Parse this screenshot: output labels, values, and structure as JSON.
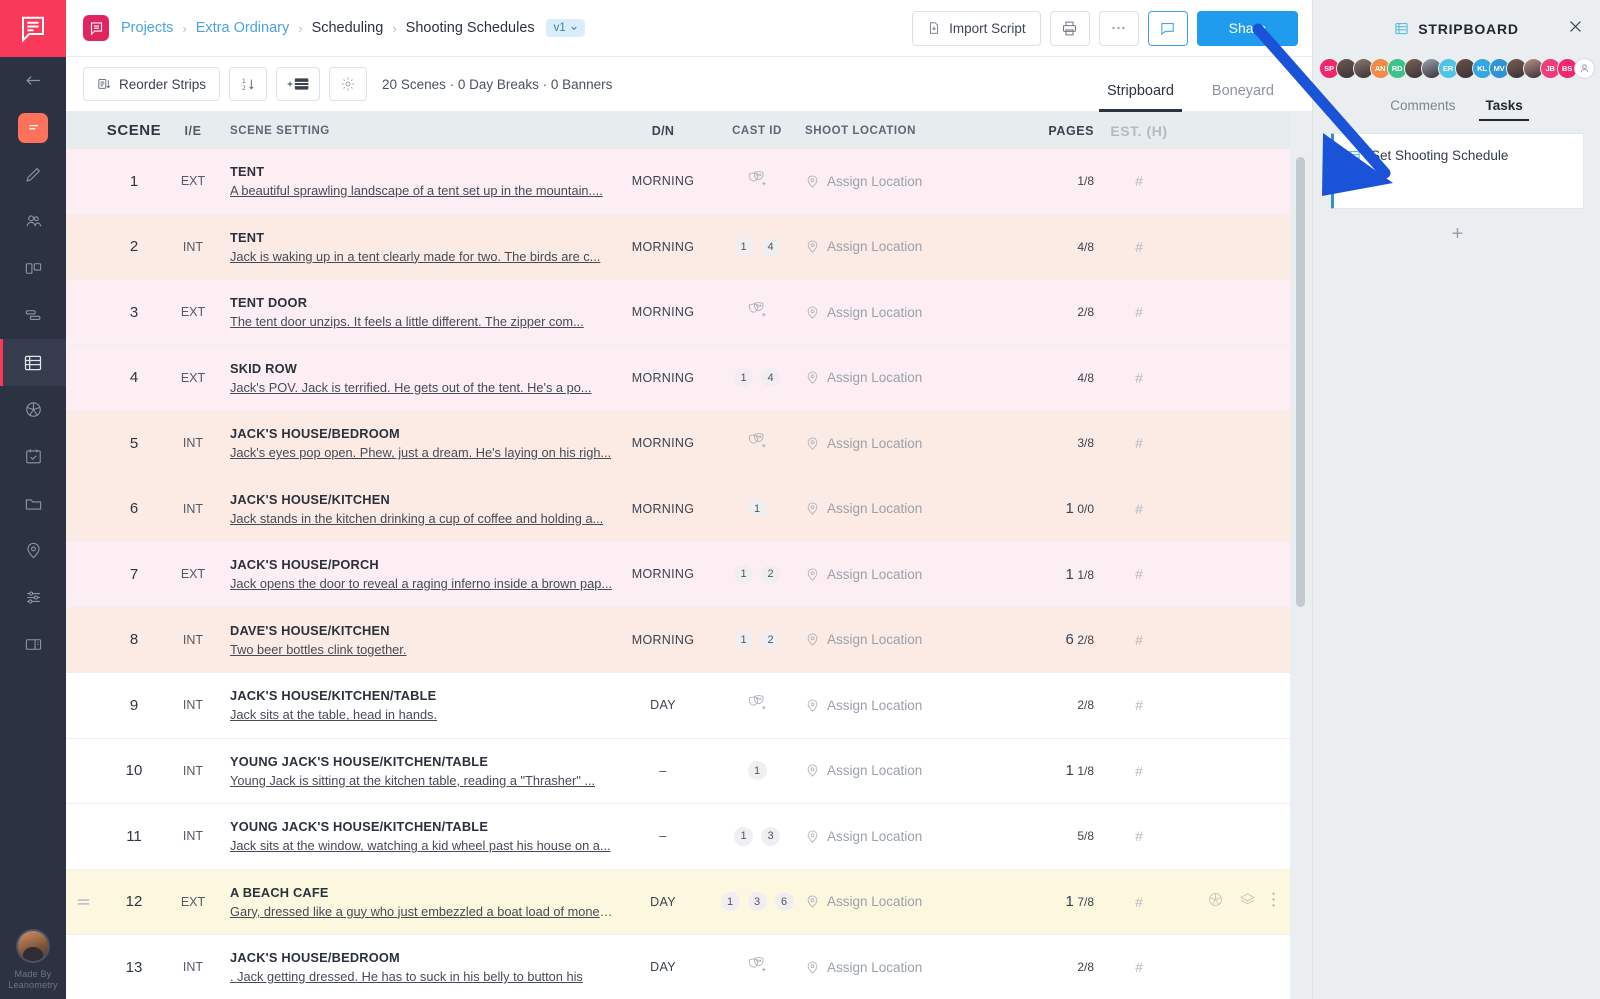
{
  "rail": {
    "logo_icon": "comment-script-logo",
    "items": [
      {
        "name": "collapse-sidebar",
        "icon": "arrow-left-icon"
      },
      {
        "name": "script-tile",
        "icon": "script-tile-icon",
        "active_tile": true
      },
      {
        "name": "write",
        "icon": "pencil-icon"
      },
      {
        "name": "cast",
        "icon": "people-icon"
      },
      {
        "name": "storyboard",
        "icon": "boards-icon"
      },
      {
        "name": "breakdown",
        "icon": "strips-icon"
      },
      {
        "name": "scheduling",
        "icon": "stripboard-icon",
        "selected": true
      },
      {
        "name": "shot-list",
        "icon": "aperture-icon"
      },
      {
        "name": "calendar",
        "icon": "calendar-check-icon"
      },
      {
        "name": "files",
        "icon": "folder-icon"
      },
      {
        "name": "locations",
        "icon": "map-pin-icon"
      },
      {
        "name": "settings-sliders",
        "icon": "sliders-icon"
      },
      {
        "name": "reports",
        "icon": "book-icon"
      }
    ],
    "credit_line1": "Made By",
    "credit_line2": "Leanometry"
  },
  "breadcrumb": {
    "items": [
      {
        "label": "Projects",
        "style": "link"
      },
      {
        "label": "Extra Ordinary",
        "style": "link"
      },
      {
        "label": "Scheduling",
        "style": "dark"
      },
      {
        "label": "Shooting Schedules",
        "style": "dark"
      }
    ],
    "separator": "›",
    "version_label": "v1"
  },
  "topbar": {
    "import_script_label": "Import Script",
    "print_icon": "printer-icon",
    "more_icon": "ellipsis-icon",
    "comments_icon": "comment-bubble-icon",
    "share_label": "Share",
    "share_color": "#209cee"
  },
  "toolbar": {
    "reorder_label": "Reorder Strips",
    "sort_icon": "sort-1-2-icon",
    "add_strip_icon": "add-strip-icon",
    "settings_icon": "gear-icon",
    "meta": "20 Scenes · 0 Day Breaks · 0 Banners",
    "tabs": [
      {
        "label": "Stripboard",
        "active": true
      },
      {
        "label": "Boneyard",
        "active": false
      }
    ]
  },
  "table": {
    "columns": {
      "scene": "SCENE",
      "ie": "I/E",
      "setting": "SCENE SETTING",
      "dn": "D/N",
      "cast": "CAST ID",
      "location": "SHOOT LOCATION",
      "pages": "PAGES",
      "est": "EST. (H)"
    },
    "assign_location_label": "Assign Location",
    "est_placeholder": "#",
    "rows": [
      {
        "scene": "1",
        "ie": "EXT",
        "title": "TENT",
        "desc": "A beautiful sprawling landscape of a tent set up in the mountain....",
        "dn": "MORNING",
        "cast": [],
        "cast_icon": "add-cast-masks-icon",
        "pages_whole": "",
        "pages_frac": "1/8",
        "tint": "pink-light"
      },
      {
        "scene": "2",
        "ie": "INT",
        "title": "TENT",
        "desc": "Jack is waking up in a tent clearly made for two. The birds are c...",
        "dn": "MORNING",
        "cast": [
          "1",
          "4"
        ],
        "pages_whole": "",
        "pages_frac": "4/8",
        "tint": "peach"
      },
      {
        "scene": "3",
        "ie": "EXT",
        "title": "TENT DOOR",
        "desc": "The tent door unzips. It feels a little different. The zipper com...",
        "dn": "MORNING",
        "cast": [],
        "cast_icon": "add-cast-masks-icon",
        "pages_whole": "",
        "pages_frac": "2/8",
        "tint": "pink-light"
      },
      {
        "scene": "4",
        "ie": "EXT",
        "title": "SKID ROW",
        "desc": "Jack's POV. Jack is terrified. He gets out of the tent. He's a po...",
        "dn": "MORNING",
        "cast": [
          "1",
          "4"
        ],
        "pages_whole": "",
        "pages_frac": "4/8",
        "tint": "pink-light"
      },
      {
        "scene": "5",
        "ie": "INT",
        "title": "JACK'S HOUSE/BEDROOM",
        "desc": "Jack's eyes pop open. Phew, just a dream. He's laying on his righ...",
        "dn": "MORNING",
        "cast": [],
        "cast_icon": "add-cast-masks-icon",
        "pages_whole": "",
        "pages_frac": "3/8",
        "tint": "peach"
      },
      {
        "scene": "6",
        "ie": "INT",
        "title": "JACK'S HOUSE/KITCHEN",
        "desc": "Jack stands in the kitchen drinking a cup of coffee and holding a...",
        "dn": "MORNING",
        "cast": [
          "1"
        ],
        "pages_whole": "1",
        "pages_frac": "0/0",
        "tint": "peach"
      },
      {
        "scene": "7",
        "ie": "EXT",
        "title": "JACK'S HOUSE/PORCH",
        "desc": "Jack opens the door to reveal a raging inferno inside a brown pap...",
        "dn": "MORNING",
        "cast": [
          "1",
          "2"
        ],
        "pages_whole": "1",
        "pages_frac": "1/8",
        "tint": "pink-light"
      },
      {
        "scene": "8",
        "ie": "INT",
        "title": "DAVE'S HOUSE/KITCHEN",
        "desc": "Two beer bottles clink together.",
        "dn": "MORNING",
        "cast": [
          "1",
          "2"
        ],
        "pages_whole": "6",
        "pages_frac": "2/8",
        "tint": "peach"
      },
      {
        "scene": "9",
        "ie": "INT",
        "title": "JACK'S HOUSE/KITCHEN/TABLE",
        "desc": "Jack sits at the table, head in hands.",
        "dn": "DAY",
        "cast": [],
        "cast_icon": "add-cast-masks-icon",
        "pages_whole": "",
        "pages_frac": "2/8",
        "tint": "white"
      },
      {
        "scene": "10",
        "ie": "INT",
        "title": "YOUNG JACK'S HOUSE/KITCHEN/TABLE",
        "desc": "Young Jack is sitting at the kitchen table, reading a \"Thrasher\" ...",
        "dn": "–",
        "cast": [
          "1"
        ],
        "pages_whole": "1",
        "pages_frac": "1/8",
        "tint": "white"
      },
      {
        "scene": "11",
        "ie": "INT",
        "title": "YOUNG JACK'S HOUSE/KITCHEN/TABLE",
        "desc": "Jack sits at the window, watching a kid wheel past his house on a...",
        "dn": "–",
        "cast": [
          "1",
          "3"
        ],
        "pages_whole": "",
        "pages_frac": "5/8",
        "tint": "white"
      },
      {
        "scene": "12",
        "ie": "EXT",
        "title": "A BEACH CAFE",
        "desc": "Gary, dressed like a guy who just embezzled a boat load of money ...",
        "dn": "DAY",
        "cast": [
          "1",
          "3",
          "6"
        ],
        "pages_whole": "1",
        "pages_frac": "7/8",
        "tint": "yellow",
        "hovered": true,
        "actions": [
          "aperture-icon",
          "layers-icon",
          "kebab-menu-icon"
        ]
      },
      {
        "scene": "13",
        "ie": "INT",
        "title": "JACK'S HOUSE/BEDROOM",
        "desc": ". Jack getting dressed. He has to suck in his belly to button his",
        "dn": "DAY",
        "cast": [],
        "cast_icon": "add-cast-masks-icon",
        "pages_whole": "",
        "pages_frac": "2/8",
        "tint": "white"
      }
    ]
  },
  "right_panel": {
    "title": "STRIPBOARD",
    "title_icon": "stripboard-icon",
    "close_icon": "close-icon",
    "avatars": [
      {
        "initials": "SP",
        "color": "#f0276b",
        "photo": false
      },
      {
        "initials": "",
        "color": "#6d5b4e",
        "photo": true
      },
      {
        "initials": "",
        "color": "#8a7b6c",
        "photo": true
      },
      {
        "initials": "AN",
        "color": "#f08b4a",
        "photo": false
      },
      {
        "initials": "RD",
        "color": "#3cc28b",
        "photo": false
      },
      {
        "initials": "",
        "color": "#7b6452",
        "photo": true
      },
      {
        "initials": "",
        "color": "#9aa3ae",
        "photo": true
      },
      {
        "initials": "ER",
        "color": "#4ec4e8",
        "photo": false
      },
      {
        "initials": "",
        "color": "#6b5344",
        "photo": true
      },
      {
        "initials": "KL",
        "color": "#35a8e0",
        "photo": false
      },
      {
        "initials": "MV",
        "color": "#2f93d8",
        "photo": false
      },
      {
        "initials": "",
        "color": "#7a6050",
        "photo": true
      },
      {
        "initials": "",
        "color": "#b59383",
        "photo": true
      },
      {
        "initials": "JB",
        "color": "#ef3d7a",
        "photo": false
      },
      {
        "initials": "BS",
        "color": "#f0276b",
        "photo": false
      },
      {
        "initials": "+",
        "color": "#ffffff",
        "photo": false,
        "is_plus": true
      }
    ],
    "tabs": [
      {
        "label": "Comments",
        "active": false
      },
      {
        "label": "Tasks",
        "active": true
      }
    ],
    "task": {
      "label": "Set Shooting Schedule",
      "icon": "stripboard-icon",
      "accent": "#3b8fc4"
    },
    "add_label": "+"
  },
  "annotation": {
    "arrow_color": "#1a53d8"
  }
}
